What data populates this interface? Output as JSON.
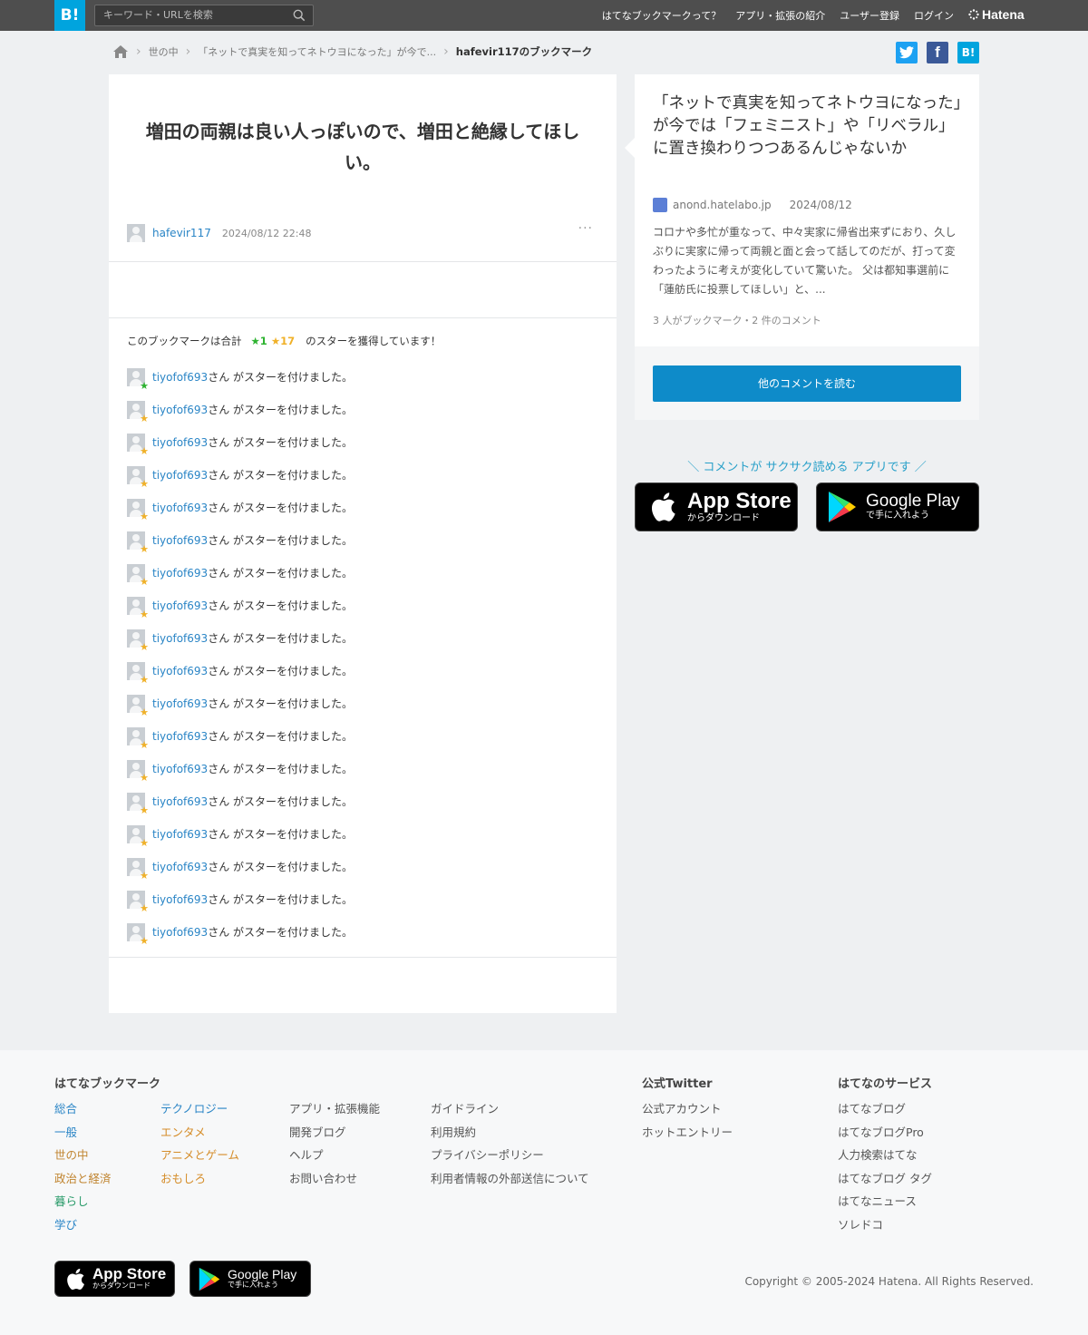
{
  "header": {
    "logo": "B!",
    "search_placeholder": "キーワード・URLを検索",
    "nav": [
      "はてなブックマークって？",
      "アプリ・拡張の紹介",
      "ユーザー登録",
      "ログイン"
    ],
    "hatena": "Hatena"
  },
  "breadcrumb": {
    "category": "世の中",
    "entry": "「ネットで真実を知ってネトウヨになった」が今で...",
    "current": "hafevir117のブックマーク"
  },
  "share": {
    "twitter": "t",
    "facebook": "f",
    "hatena": "B!"
  },
  "bookmark": {
    "comment": "増田の両親は良い人っぽいので、増田と絶縁してほしい。",
    "user": "hafevir117",
    "timestamp": "2024/08/12 22:48",
    "more": "···"
  },
  "stars": {
    "summary_prefix": "このブックマークは合計",
    "green_count": "★1",
    "yellow_count": "★17",
    "summary_suffix": "のスターを獲得しています！",
    "entries": [
      {
        "user": "tiyofof693",
        "text": "さん がスターを付けました。",
        "color": "green"
      },
      {
        "user": "tiyofof693",
        "text": "さん がスターを付けました。",
        "color": "yellow"
      },
      {
        "user": "tiyofof693",
        "text": "さん がスターを付けました。",
        "color": "yellow"
      },
      {
        "user": "tiyofof693",
        "text": "さん がスターを付けました。",
        "color": "yellow"
      },
      {
        "user": "tiyofof693",
        "text": "さん がスターを付けました。",
        "color": "yellow"
      },
      {
        "user": "tiyofof693",
        "text": "さん がスターを付けました。",
        "color": "yellow"
      },
      {
        "user": "tiyofof693",
        "text": "さん がスターを付けました。",
        "color": "yellow"
      },
      {
        "user": "tiyofof693",
        "text": "さん がスターを付けました。",
        "color": "yellow"
      },
      {
        "user": "tiyofof693",
        "text": "さん がスターを付けました。",
        "color": "yellow"
      },
      {
        "user": "tiyofof693",
        "text": "さん がスターを付けました。",
        "color": "yellow"
      },
      {
        "user": "tiyofof693",
        "text": "さん がスターを付けました。",
        "color": "yellow"
      },
      {
        "user": "tiyofof693",
        "text": "さん がスターを付けました。",
        "color": "yellow"
      },
      {
        "user": "tiyofof693",
        "text": "さん がスターを付けました。",
        "color": "yellow"
      },
      {
        "user": "tiyofof693",
        "text": "さん がスターを付けました。",
        "color": "yellow"
      },
      {
        "user": "tiyofof693",
        "text": "さん がスターを付けました。",
        "color": "yellow"
      },
      {
        "user": "tiyofof693",
        "text": "さん がスターを付けました。",
        "color": "yellow"
      },
      {
        "user": "tiyofof693",
        "text": "さん がスターを付けました。",
        "color": "yellow"
      },
      {
        "user": "tiyofof693",
        "text": "さん がスターを付けました。",
        "color": "yellow"
      }
    ]
  },
  "entry": {
    "title": "「ネットで真実を知ってネトウヨになった」が今では「フェミニスト」や「リベラル」に置き換わりつつあるんじゃないか",
    "domain": "anond.hatelabo.jp",
    "date": "2024/08/12",
    "summary": "コロナや多忙が重なって、中々実家に帰省出来ずにおり、久しぶりに実家に帰って両親と面と会って話してのだが、打って変わったように考えが変化していて驚いた。 父は都知事選前に「蓮舫氏に投票してほしい」と、...",
    "count": "3 人がブックマーク・2 件のコメント",
    "read_comments": "他のコメントを読む"
  },
  "app_promo": {
    "tagline": "＼ コメントが サクサク読める アプリです ／",
    "appstore_big": "App Store",
    "appstore_small": "からダウンロード",
    "googleplay_big": "Google Play",
    "googleplay_small": "で手に入れよう"
  },
  "footer": {
    "heading_bookmark": "はてなブックマーク",
    "categories_a": [
      "総合",
      "一般",
      "世の中",
      "政治と経済",
      "暮らし",
      "学び"
    ],
    "categories_b": [
      "テクノロジー",
      "エンタメ",
      "アニメとゲーム",
      "おもしろ"
    ],
    "links_a": [
      "アプリ・拡張機能",
      "開発ブログ",
      "ヘルプ",
      "お問い合わせ"
    ],
    "links_b": [
      "ガイドライン",
      "利用規約",
      "プライバシーポリシー",
      "利用者情報の外部送信について"
    ],
    "heading_twitter": "公式Twitter",
    "twitter_links": [
      "公式アカウント",
      "ホットエントリー"
    ],
    "heading_services": "はてなのサービス",
    "services": [
      "はてなブログ",
      "はてなブログPro",
      "人力検索はてな",
      "はてなブログ タグ",
      "はてなニュース",
      "ソレドコ"
    ],
    "copyright": "Copyright © 2005-2024 Hatena. All Rights Reserved.",
    "category_colors": {
      "総合": "#2a85c6",
      "一般": "#2a85c6",
      "世の中": "#c0842f",
      "政治と経済": "#c0842f",
      "暮らし": "#2a9b6a",
      "学び": "#2a85c6",
      "テクノロジー": "#2a85c6",
      "エンタメ": "#d58d2a",
      "アニメとゲーム": "#d58d2a",
      "おもしろ": "#d58d2a"
    }
  },
  "colors": {
    "accent": "#00a4de",
    "button": "#0e8bc9",
    "link": "#2a85c6",
    "star_green": "#2db330",
    "star_yellow": "#f0b129"
  }
}
